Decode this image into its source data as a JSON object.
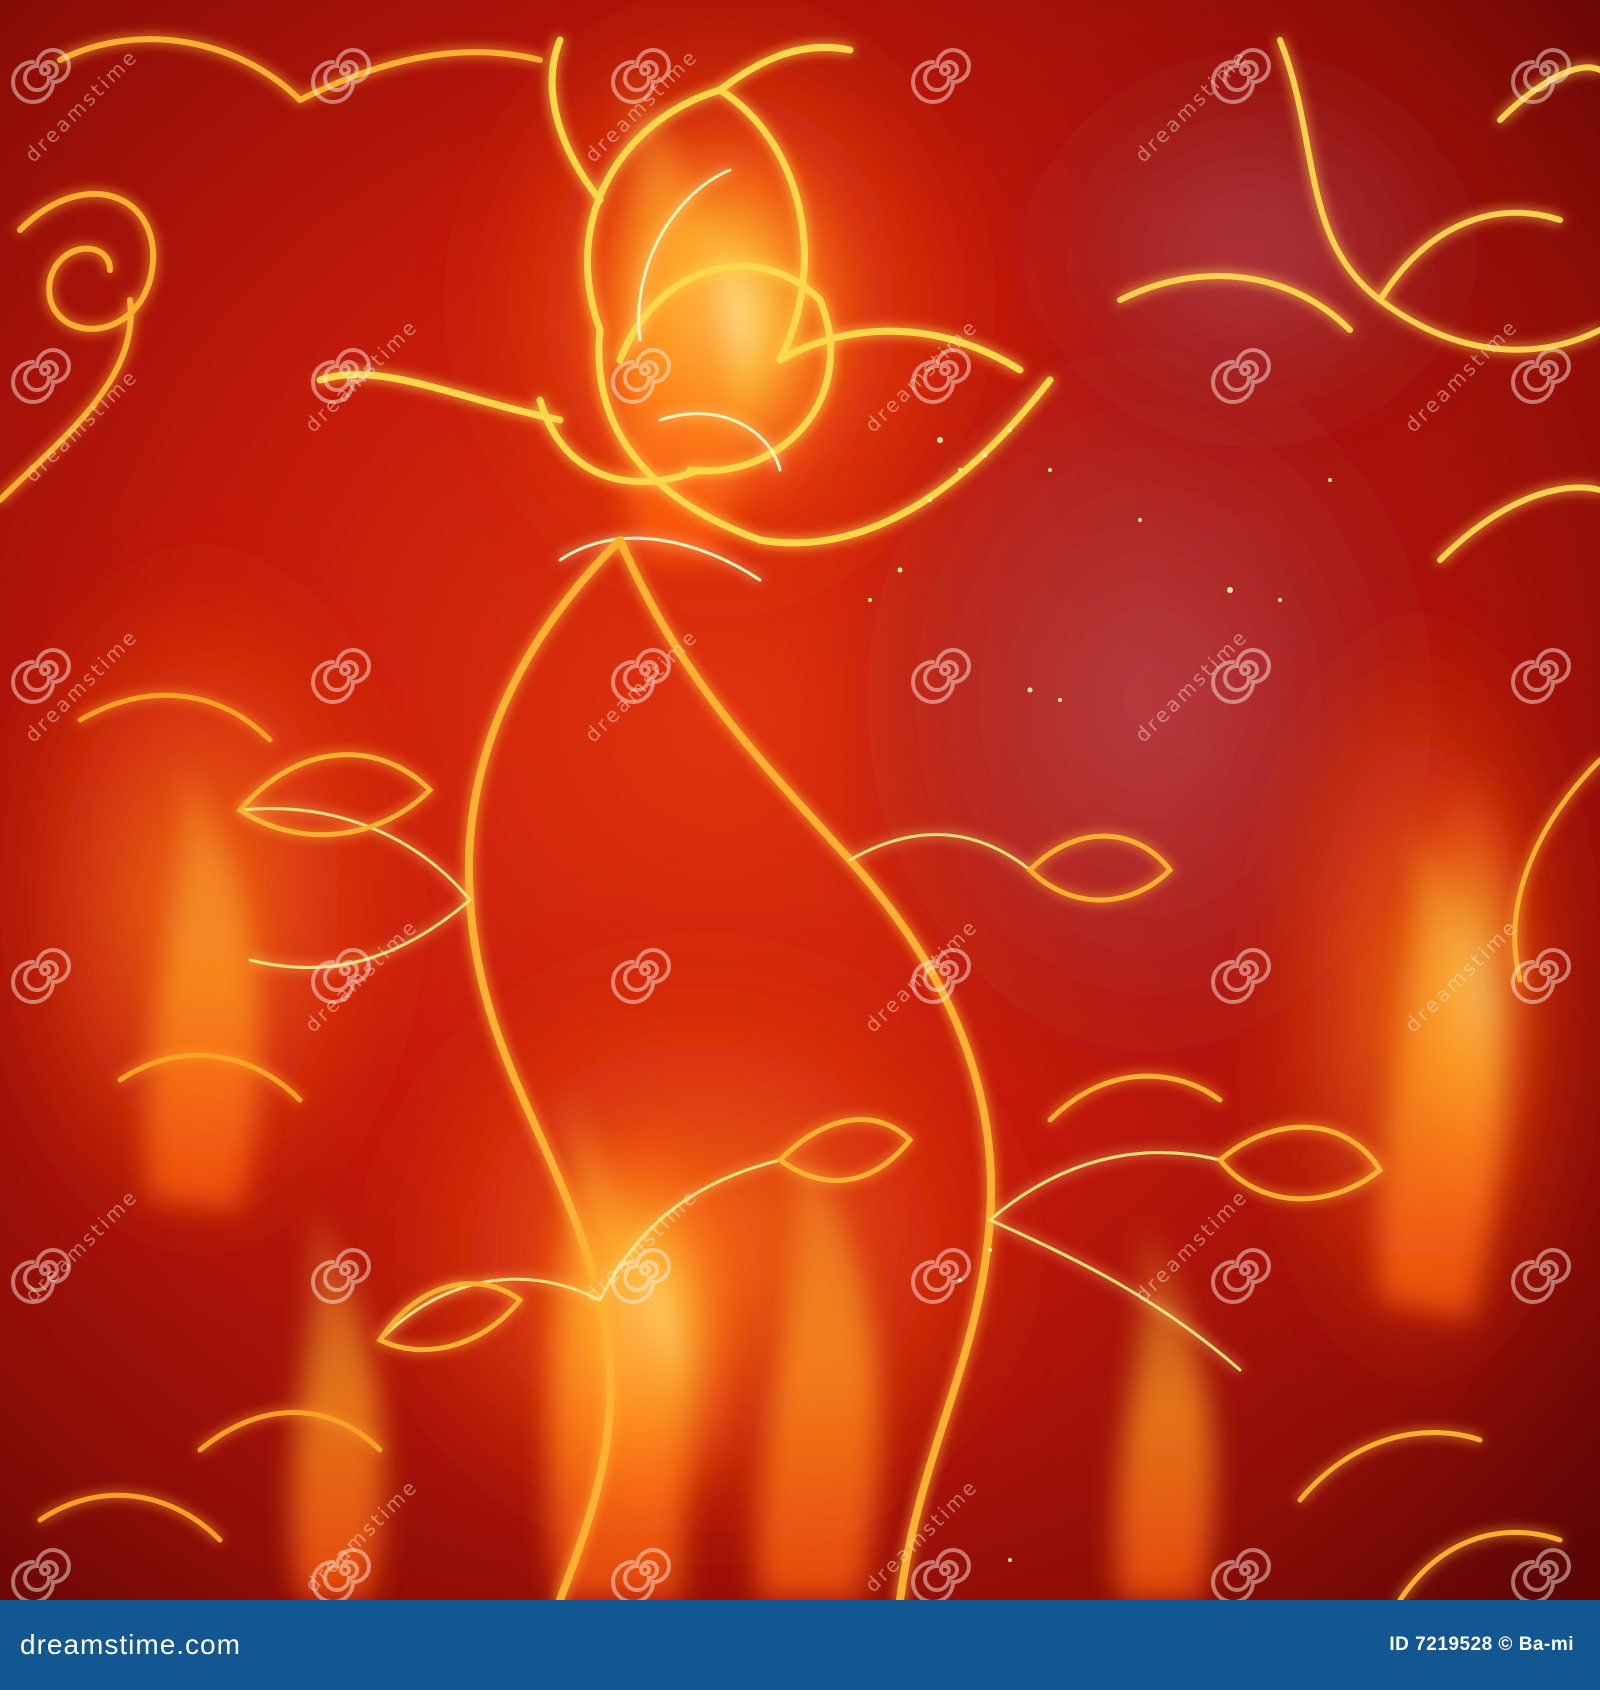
{
  "image": {
    "subject": "stylized rose made of fire",
    "background_color": "#8e0d07",
    "palette": {
      "deep_red": "#6b0707",
      "red": "#c2160a",
      "orange": "#f45a10",
      "amber": "#ff9a1f",
      "yellow": "#ffd64a",
      "white_hot": "#fff4b8",
      "smoke": "#b85560"
    }
  },
  "watermark": {
    "diagonal_text": "dreamstime",
    "spiral_icon": "spiral-logo-icon"
  },
  "footer": {
    "site_text": "dreamstime.com",
    "credit_text": "ID 7219528 © Ba-mi",
    "background": "#125792",
    "text_color": "#ffffff"
  }
}
